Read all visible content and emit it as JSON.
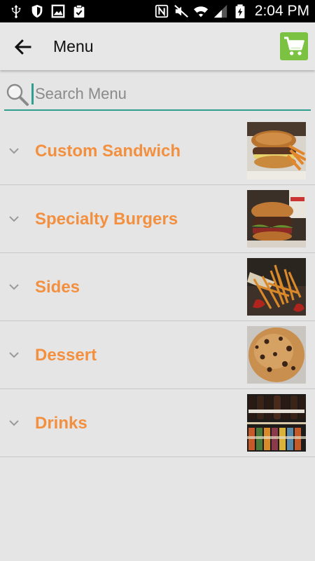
{
  "status_bar": {
    "time": "2:04 PM",
    "left_icons": [
      "usb-icon",
      "shield-icon",
      "image-icon",
      "clipboard-icon"
    ],
    "right_icons": [
      "nfc-icon",
      "mute-icon",
      "wifi-icon",
      "signal-icon",
      "battery-charging-icon"
    ]
  },
  "app_bar": {
    "title": "Menu",
    "back_icon": "arrow-back-icon",
    "cart_icon": "shopping-cart-icon",
    "cart_color": "#7cc242"
  },
  "search": {
    "placeholder": "Search Menu",
    "value": "",
    "accent_color": "#2e9e8f"
  },
  "menu": {
    "label_color": "#f39040",
    "items": [
      {
        "label": "Custom Sandwich",
        "image": "sandwich-image"
      },
      {
        "label": "Specialty Burgers",
        "image": "burger-image"
      },
      {
        "label": "Sides",
        "image": "fries-image"
      },
      {
        "label": "Dessert",
        "image": "cookie-image"
      },
      {
        "label": "Drinks",
        "image": "drinks-image"
      }
    ]
  }
}
